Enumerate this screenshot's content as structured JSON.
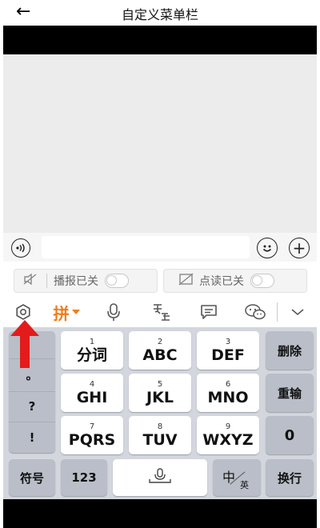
{
  "header": {
    "back_icon": "arrow-left-icon",
    "title": "自定义菜单栏"
  },
  "input_bar": {
    "voice_icon": "speaker-wave-icon",
    "emoji_icon": "smiley-icon",
    "add_icon": "plus-icon"
  },
  "toggles": [
    {
      "icon": "muted-speaker-icon",
      "label": "播报已关",
      "state": "off"
    },
    {
      "icon": "no-image-icon",
      "label": "点读已关",
      "state": "off"
    }
  ],
  "toolbar": {
    "pinyin_label": "拼",
    "accent": "#f07c1a"
  },
  "keyboard": {
    "left_column": [
      "。",
      "?",
      "!"
    ],
    "keys": [
      {
        "num": "1",
        "label": "分词"
      },
      {
        "num": "2",
        "label": "ABC"
      },
      {
        "num": "3",
        "label": "DEF"
      },
      {
        "num": "4",
        "label": "GHI"
      },
      {
        "num": "5",
        "label": "JKL"
      },
      {
        "num": "6",
        "label": "MNO"
      },
      {
        "num": "7",
        "label": "PQRS"
      },
      {
        "num": "8",
        "label": "TUV"
      },
      {
        "num": "9",
        "label": "WXYZ"
      }
    ],
    "right_column": [
      "删除",
      "重输",
      "0"
    ],
    "bottom_row": {
      "symbols": "符号",
      "numbers": "123",
      "lang_main": "中",
      "lang_sub": "英",
      "enter": "换行"
    }
  },
  "annotation": {
    "arrow_color": "#e41b1b"
  }
}
